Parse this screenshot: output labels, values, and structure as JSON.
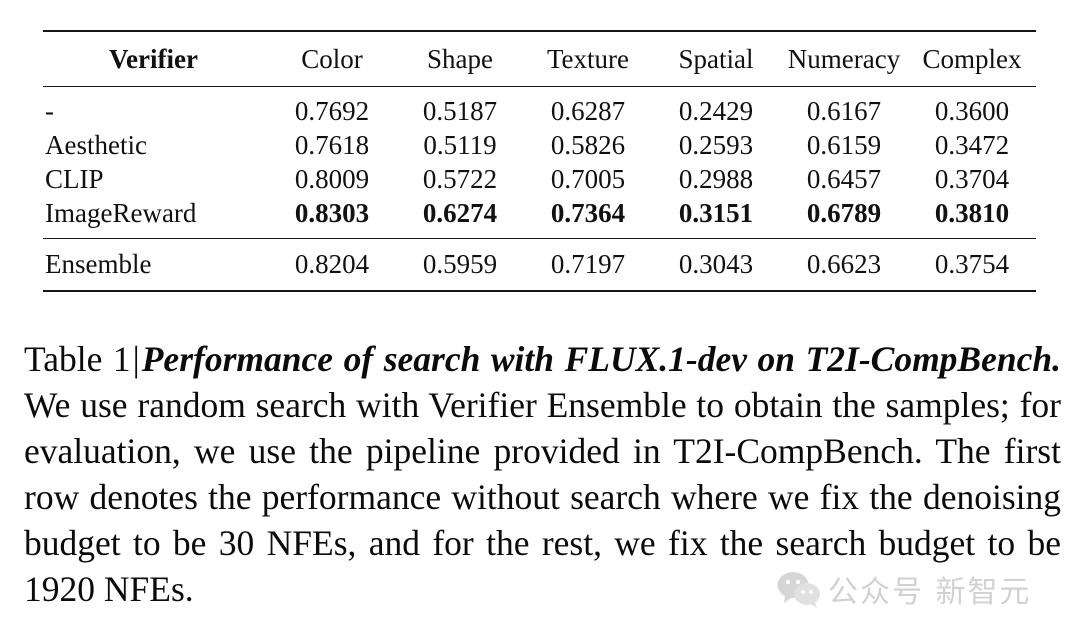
{
  "table": {
    "columns": [
      "Verifier",
      "Color",
      "Shape",
      "Texture",
      "Spatial",
      "Numeracy",
      "Complex"
    ],
    "rows": [
      {
        "verifier": "-",
        "bold": false,
        "values": [
          "0.7692",
          "0.5187",
          "0.6287",
          "0.2429",
          "0.6167",
          "0.3600"
        ]
      },
      {
        "verifier": "Aesthetic",
        "bold": false,
        "values": [
          "0.7618",
          "0.5119",
          "0.5826",
          "0.2593",
          "0.6159",
          "0.3472"
        ]
      },
      {
        "verifier": "CLIP",
        "bold": false,
        "values": [
          "0.8009",
          "0.5722",
          "0.7005",
          "0.2988",
          "0.6457",
          "0.3704"
        ]
      },
      {
        "verifier": "ImageReward",
        "bold": true,
        "values": [
          "0.8303",
          "0.6274",
          "0.7364",
          "0.3151",
          "0.6789",
          "0.3810"
        ]
      }
    ],
    "summary_row": {
      "verifier": "Ensemble",
      "bold": false,
      "values": [
        "0.8204",
        "0.5959",
        "0.7197",
        "0.3043",
        "0.6623",
        "0.3754"
      ]
    }
  },
  "caption": {
    "label": "Table 1",
    "separator": "|",
    "title": "Performance of search with FLUX.1-dev on T2I-CompBench.",
    "body": "We use random search with Verifier Ensemble to obtain the samples; for evaluation, we use the pipeline provided in T2I-CompBench. The first row denotes the performance without search where we fix the denoising budget to be 30 NFEs, and for the rest, we fix the search budget to be 1920 NFEs."
  },
  "watermark": {
    "icon": "wechat-icon",
    "text": "公众号 新智元",
    "color": "#8f8f8f"
  },
  "theme": {
    "background": "#ffffff",
    "text": "#111111",
    "rule": "#161616"
  }
}
